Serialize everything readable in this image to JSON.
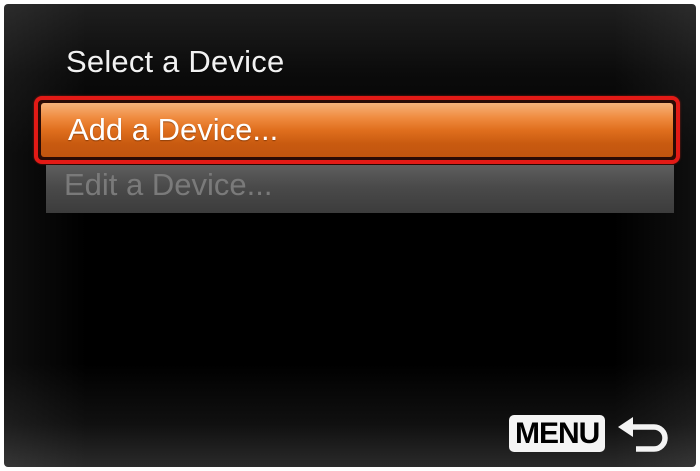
{
  "screen": {
    "title": "Select a Device"
  },
  "menu": {
    "items": [
      {
        "label": "Add a Device...",
        "state": "selected"
      },
      {
        "label": "Edit a Device...",
        "state": "disabled"
      }
    ]
  },
  "footer": {
    "menu_key_label": "MENU",
    "back_icon": "return-arrow-icon"
  },
  "colors": {
    "selection_border": "#e31a16",
    "selection_fill": "#e06f1e",
    "disabled_fill": "#4a4a4a",
    "background": "#000000"
  }
}
